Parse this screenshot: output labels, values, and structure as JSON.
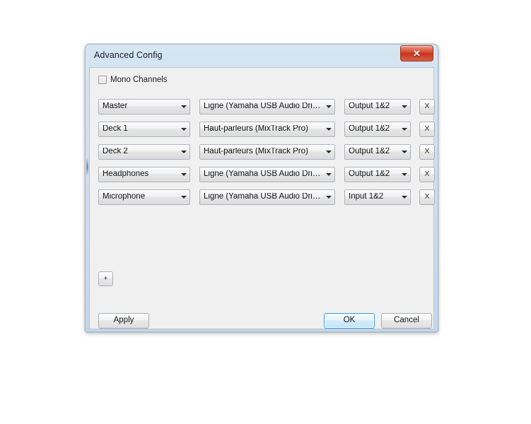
{
  "window": {
    "title": "Advanced Config",
    "close_icon": "close-icon",
    "close_glyph": "✕"
  },
  "options": {
    "mono_channels_label": "Mono Channels",
    "mono_channels_checked": false
  },
  "rows": [
    {
      "channel": "Master",
      "device": "Ligne (Yamaha USB Audio Driver)",
      "port": "Output 1&2",
      "remove_label": "X"
    },
    {
      "channel": "Deck 1",
      "device": "Haut-parleurs (MixTrack Pro)",
      "port": "Output 1&2",
      "remove_label": "X"
    },
    {
      "channel": "Deck 2",
      "device": "Haut-parleurs (MixTrack Pro)",
      "port": "Output 1&2",
      "remove_label": "X"
    },
    {
      "channel": "Headphones",
      "device": "Ligne (Yamaha USB Audio Driver)",
      "port": "Output 1&2",
      "remove_label": "X"
    },
    {
      "channel": "Microphone",
      "device": "Ligne (Yamaha USB Audio Driver)",
      "port": "Input 1&2",
      "remove_label": "X"
    }
  ],
  "add_row_label": "+",
  "footer": {
    "apply_label": "Apply",
    "ok_label": "OK",
    "cancel_label": "Cancel"
  },
  "colors": {
    "titlebar_top": "#d6e5f2",
    "titlebar_bottom": "#c3d7ea",
    "client_background": "#f0f0f0",
    "close_button": "#d0412a",
    "focus_blue": "#3c9cd6"
  }
}
